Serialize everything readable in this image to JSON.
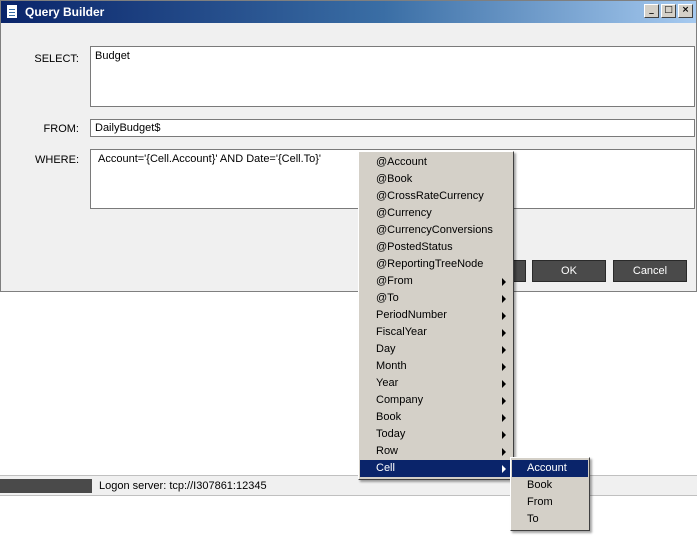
{
  "window": {
    "title": "Query Builder",
    "controls": {
      "minimize": "_",
      "maximize": "□",
      "close": "×"
    }
  },
  "form": {
    "select_label": "SELECT:",
    "select_value": "Budget",
    "from_label": "FROM:",
    "from_value": "DailyBudget$",
    "where_label": "WHERE:",
    "where_value": "Account='{Cell.Account}' AND Date='{Cell.To}'"
  },
  "buttons": {
    "ok": "OK",
    "cancel": "Cancel"
  },
  "statusbar": {
    "logon": "Logon server: tcp://I307861:12345"
  },
  "context_menu": {
    "items": [
      {
        "label": "@Account",
        "has_submenu": false
      },
      {
        "label": "@Book",
        "has_submenu": false
      },
      {
        "label": "@CrossRateCurrency",
        "has_submenu": false
      },
      {
        "label": "@Currency",
        "has_submenu": false
      },
      {
        "label": "@CurrencyConversions",
        "has_submenu": false
      },
      {
        "label": "@PostedStatus",
        "has_submenu": false
      },
      {
        "label": "@ReportingTreeNode",
        "has_submenu": false
      },
      {
        "label": "@From",
        "has_submenu": true
      },
      {
        "label": "@To",
        "has_submenu": true
      },
      {
        "label": "PeriodNumber",
        "has_submenu": true
      },
      {
        "label": "FiscalYear",
        "has_submenu": true
      },
      {
        "label": "Day",
        "has_submenu": true
      },
      {
        "label": "Month",
        "has_submenu": true
      },
      {
        "label": "Year",
        "has_submenu": true
      },
      {
        "label": "Company",
        "has_submenu": true
      },
      {
        "label": "Book",
        "has_submenu": true
      },
      {
        "label": "Today",
        "has_submenu": true
      },
      {
        "label": "Row",
        "has_submenu": true
      },
      {
        "label": "Cell",
        "has_submenu": true,
        "highlighted": true
      }
    ]
  },
  "cell_submenu": {
    "items": [
      {
        "label": "Account",
        "highlighted": true
      },
      {
        "label": "Book"
      },
      {
        "label": "From"
      },
      {
        "label": "To"
      }
    ]
  },
  "colors": {
    "menu_bg": "#d4d0c8",
    "highlight": "#0a246a",
    "dark_button": "#4a4a4a"
  }
}
